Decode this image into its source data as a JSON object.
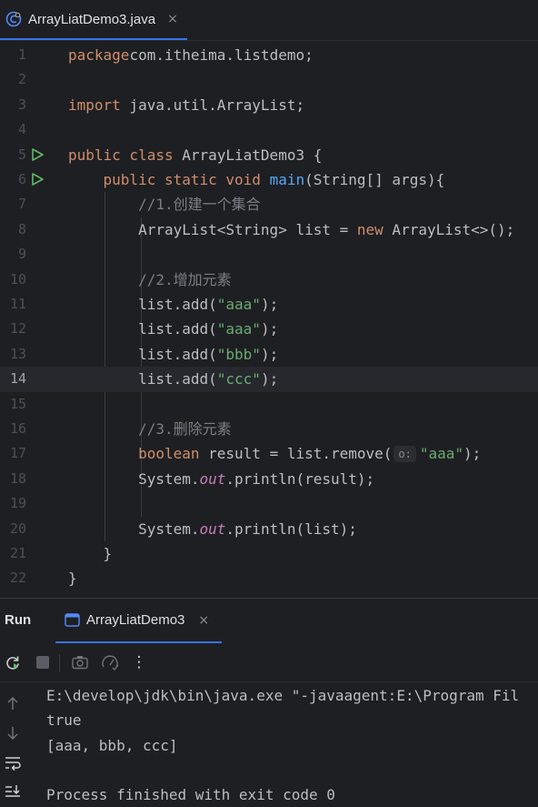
{
  "editor_tab": {
    "title": "ArrayLiatDemo3.java",
    "close": "×"
  },
  "editor": {
    "lines": [
      {
        "num": "1",
        "tokens": [
          [
            "kw",
            "package"
          ],
          [
            "",
            "com.itheima.listdemo;"
          ]
        ]
      },
      {
        "num": "2",
        "tokens": []
      },
      {
        "num": "3",
        "tokens": [
          [
            "kw",
            "import"
          ],
          [
            "",
            " java.util.ArrayList;"
          ]
        ]
      },
      {
        "num": "4",
        "tokens": []
      },
      {
        "num": "5",
        "run": true,
        "tokens": [
          [
            "kw",
            "public class"
          ],
          [
            "",
            " ArrayLiatDemo3 {"
          ]
        ]
      },
      {
        "num": "6",
        "run": true,
        "tokens": [
          [
            "",
            "    "
          ],
          [
            "kw",
            "public static void"
          ],
          [
            "",
            " "
          ],
          [
            "fn",
            "main"
          ],
          [
            "",
            "(String[] args){"
          ]
        ]
      },
      {
        "num": "7",
        "tokens": [
          [
            "",
            "        "
          ],
          [
            "cmt",
            "//1.创建一个集合"
          ]
        ]
      },
      {
        "num": "8",
        "tokens": [
          [
            "",
            "        ArrayList<String> list = "
          ],
          [
            "kw",
            "new"
          ],
          [
            "",
            " ArrayList<>();"
          ]
        ]
      },
      {
        "num": "9",
        "tokens": []
      },
      {
        "num": "10",
        "tokens": [
          [
            "",
            "        "
          ],
          [
            "cmt",
            "//2.增加元素"
          ]
        ]
      },
      {
        "num": "11",
        "tokens": [
          [
            "",
            "        list.add("
          ],
          [
            "str",
            "\"aaa\""
          ],
          [
            "",
            ");"
          ]
        ]
      },
      {
        "num": "12",
        "tokens": [
          [
            "",
            "        list.add("
          ],
          [
            "str",
            "\"aaa\""
          ],
          [
            "",
            ");"
          ]
        ]
      },
      {
        "num": "13",
        "tokens": [
          [
            "",
            "        list.add("
          ],
          [
            "str",
            "\"bbb\""
          ],
          [
            "",
            ");"
          ]
        ]
      },
      {
        "num": "14",
        "current": true,
        "tokens": [
          [
            "",
            "        list.add("
          ],
          [
            "str",
            "\"ccc\""
          ],
          [
            "",
            ");"
          ]
        ]
      },
      {
        "num": "15",
        "tokens": []
      },
      {
        "num": "16",
        "tokens": [
          [
            "",
            "        "
          ],
          [
            "cmt",
            "//3.删除元素"
          ]
        ]
      },
      {
        "num": "17",
        "tokens": [
          [
            "",
            "        "
          ],
          [
            "kw",
            "boolean"
          ],
          [
            "",
            " result = list.remove("
          ],
          [
            "hint",
            "o:"
          ],
          [
            "str",
            "\"aaa\""
          ],
          [
            "",
            ");"
          ]
        ]
      },
      {
        "num": "18",
        "tokens": [
          [
            "",
            "        System."
          ],
          [
            "st",
            "out"
          ],
          [
            "",
            ".println(result);"
          ]
        ]
      },
      {
        "num": "19",
        "tokens": []
      },
      {
        "num": "20",
        "tokens": [
          [
            "",
            "        System."
          ],
          [
            "st",
            "out"
          ],
          [
            "",
            ".println(list);"
          ]
        ]
      },
      {
        "num": "21",
        "tokens": [
          [
            "",
            "    }"
          ]
        ]
      },
      {
        "num": "22",
        "tokens": [
          [
            "",
            "}"
          ]
        ]
      }
    ]
  },
  "run_panel": {
    "title": "Run",
    "tab_title": "ArrayLiatDemo3",
    "close": "×"
  },
  "toolbar": {
    "more": "⋮"
  },
  "console": {
    "lines": [
      "E:\\develop\\jdk\\bin\\java.exe \"-javaagent:E:\\Program Fil",
      "true",
      "[aaa, bbb, ccc]",
      "",
      "Process finished with exit code 0"
    ]
  },
  "colors": {
    "keyword": "#cf8e6d",
    "method": "#56a8f5",
    "string": "#6aab73",
    "comment": "#7a7e85",
    "static_field": "#c77dbb",
    "accent": "#3574f0",
    "run_green": "#5fb865"
  }
}
